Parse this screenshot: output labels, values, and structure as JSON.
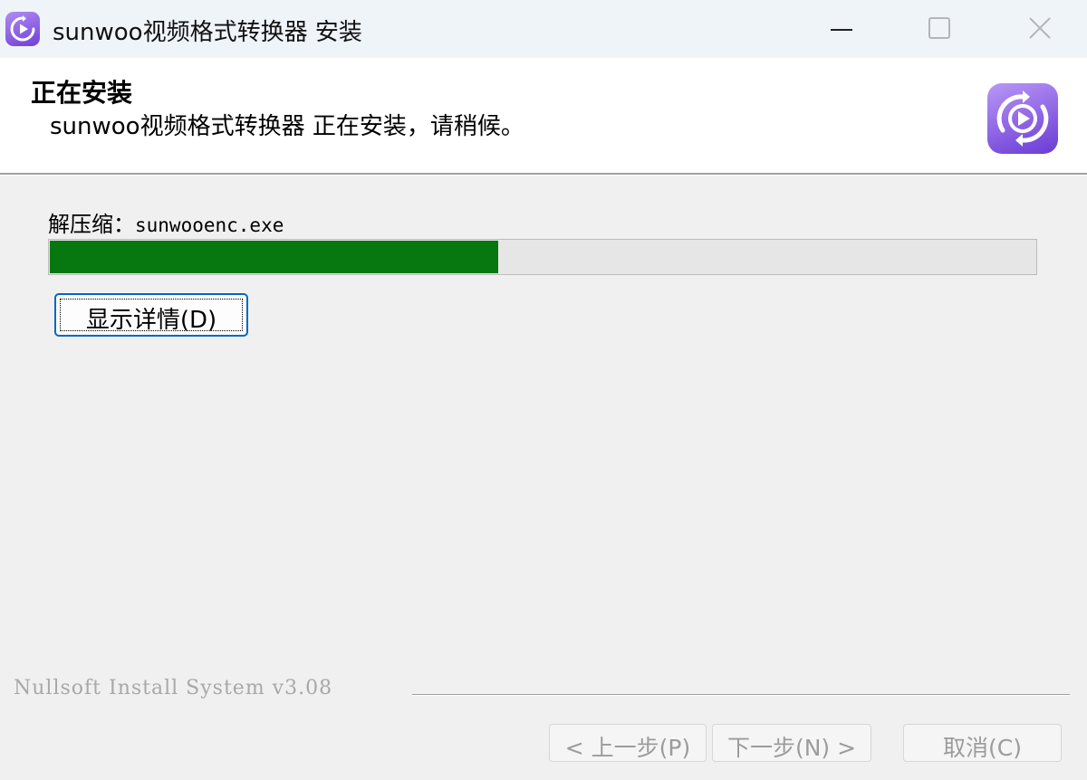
{
  "window": {
    "title": "sunwoo视频格式转换器 安装",
    "app_icon": "play-refresh-icon",
    "controls": {
      "minimize": "minimize-icon",
      "maximize": "maximize-icon",
      "close": "close-icon"
    }
  },
  "header": {
    "title": "正在安装",
    "subtitle": "sunwoo视频格式转换器 正在安装，请稍候。",
    "icon": "play-refresh-icon"
  },
  "status": {
    "label": "解压缩：",
    "file": "sunwooenc.exe"
  },
  "progress": {
    "fraction": 0.455,
    "color": "#06780f"
  },
  "details_button": {
    "label": "显示详情(D)"
  },
  "branding": {
    "text": "Nullsoft Install System v3.08"
  },
  "footer": {
    "back_label": "< 上一步(P)",
    "next_label": "下一步(N) >",
    "cancel_label": "取消(C)"
  },
  "colors": {
    "accent": "#0067c0",
    "icon_gradient_start": "#b997f7",
    "icon_gradient_end": "#6a3bd4",
    "window_bg": "#f0f0f0"
  }
}
